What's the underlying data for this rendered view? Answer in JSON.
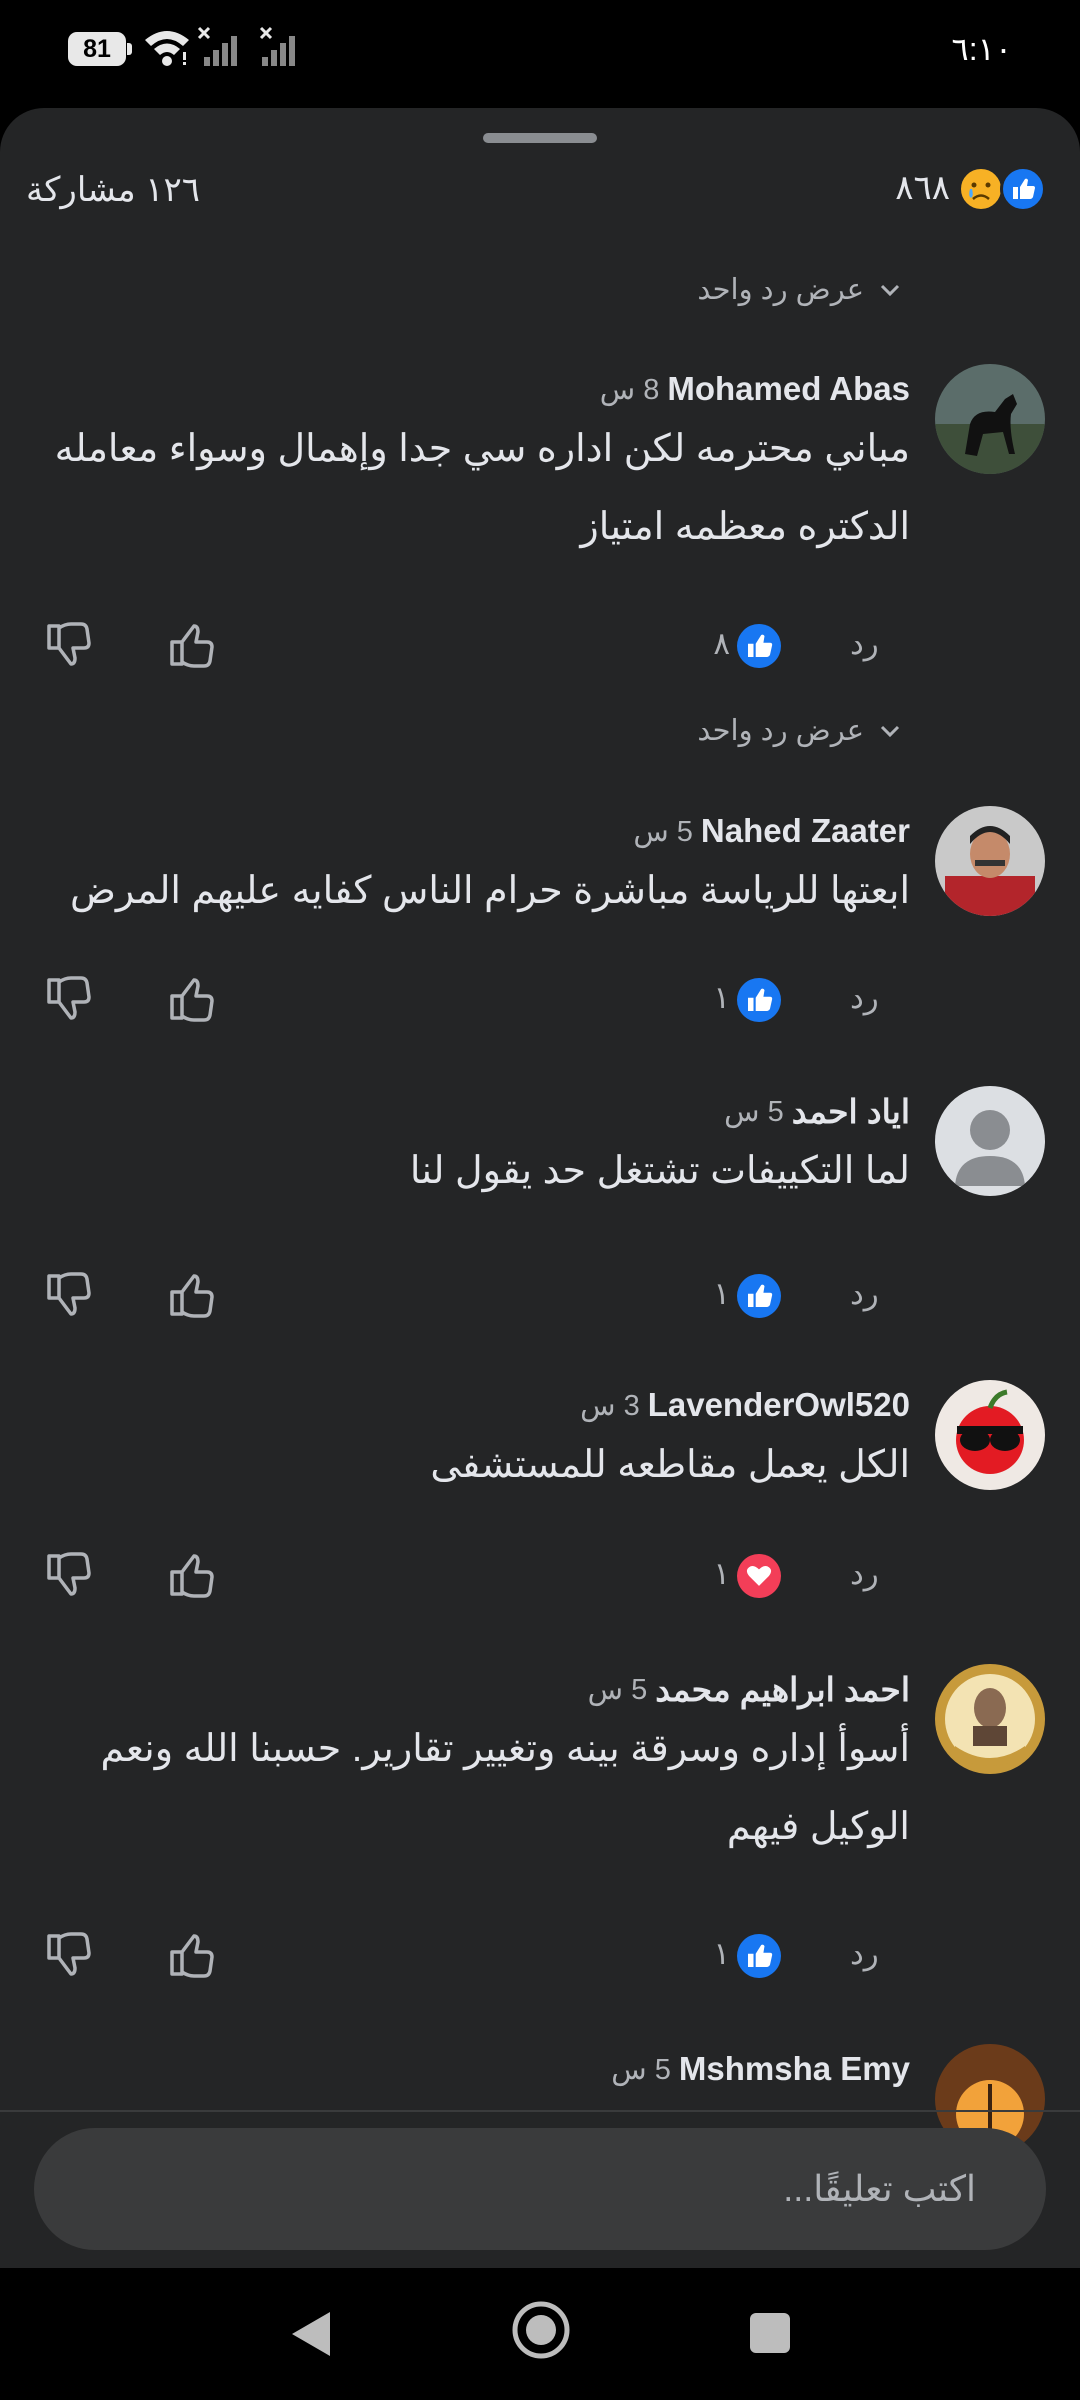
{
  "status_bar": {
    "battery": "81",
    "time": "٦:١٠"
  },
  "summary": {
    "reaction_count": "٨٦٨",
    "shares": "١٢٦ مشاركة"
  },
  "labels": {
    "view_one_reply": "عرض رد واحد",
    "reply": "رد"
  },
  "comments": [
    {
      "author": "Mohamed Abas",
      "time": "8 س",
      "text": "مباني محترمه لكن اداره سي جدا وإهمال وسواء معامله الدكتره معظمه امتياز",
      "reaction": "like",
      "reaction_count": "٨"
    },
    {
      "author": "Nahed Zaater",
      "time": "5 س",
      "text": "ابعتها للرياسة مباشرة حرام الناس كفايه عليهم المرض",
      "reaction": "like",
      "reaction_count": "١"
    },
    {
      "author": "اياد احمد",
      "time": "5 س",
      "text": "لما التكييفات تشتغل حد يقول لنا",
      "reaction": "like",
      "reaction_count": "١"
    },
    {
      "author": "LavenderOwl520",
      "time": "3 س",
      "text": "الكل يعمل مقاطعه للمستشفى",
      "reaction": "love",
      "reaction_count": "١"
    },
    {
      "author": "احمد ابراهيم محمد",
      "time": "5 س",
      "text": "أسوأ إداره وسرقة بينه وتغيير تقارير. حسبنا الله ونعم الوكيل فيهم",
      "reaction": "like",
      "reaction_count": "١"
    },
    {
      "author": "Mshmsha Emy",
      "time": "5 س"
    }
  ],
  "composer": {
    "placeholder": "اكتب تعليقًا..."
  },
  "colors": {
    "like_blue": "#1877f2",
    "love_red": "#f33e58",
    "sheet_bg": "#242526",
    "secondary_text": "#b0b3b8"
  }
}
